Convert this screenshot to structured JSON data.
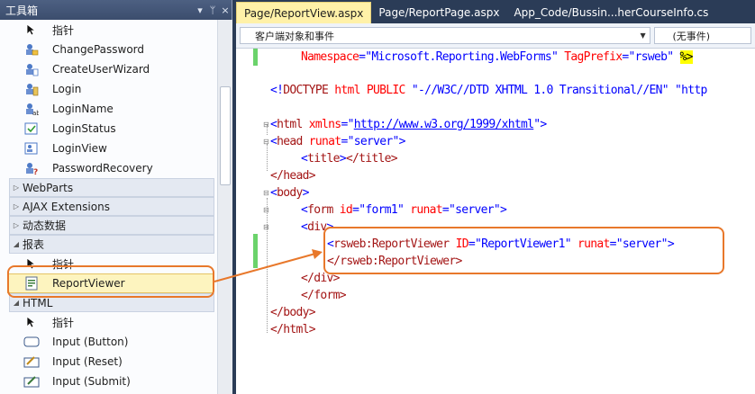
{
  "toolbox": {
    "title": "工具箱",
    "controls": [
      "▾",
      "ᛘ",
      "×"
    ],
    "login_items": [
      {
        "label": "指针",
        "icon": "pointer-icon"
      },
      {
        "label": "ChangePassword",
        "icon": "change-password-icon"
      },
      {
        "label": "CreateUserWizard",
        "icon": "create-user-wizard-icon"
      },
      {
        "label": "Login",
        "icon": "login-icon"
      },
      {
        "label": "LoginName",
        "icon": "login-name-icon"
      },
      {
        "label": "LoginStatus",
        "icon": "login-status-icon"
      },
      {
        "label": "LoginView",
        "icon": "login-view-icon"
      },
      {
        "label": "PasswordRecovery",
        "icon": "password-recovery-icon"
      }
    ],
    "categories": [
      {
        "label": "WebParts",
        "expanded": false
      },
      {
        "label": "AJAX Extensions",
        "expanded": false
      },
      {
        "label": "动态数据",
        "expanded": false
      },
      {
        "label": "报表",
        "expanded": true
      }
    ],
    "report_items": [
      {
        "label": "指针",
        "icon": "pointer-icon"
      },
      {
        "label": "ReportViewer",
        "icon": "report-viewer-icon",
        "selected": true
      }
    ],
    "html_category": {
      "label": "HTML",
      "expanded": true
    },
    "html_items": [
      {
        "label": "指针",
        "icon": "pointer-icon"
      },
      {
        "label": "Input (Button)",
        "icon": "input-button-icon"
      },
      {
        "label": "Input (Reset)",
        "icon": "input-reset-icon"
      },
      {
        "label": "Input (Submit)",
        "icon": "input-submit-icon"
      }
    ]
  },
  "editor": {
    "tabs": [
      {
        "label": "Page/ReportView.aspx",
        "active": true
      },
      {
        "label": "Page/ReportPage.aspx",
        "active": false
      },
      {
        "label": "App_Code/Bussin...herCourseInfo.cs",
        "active": false
      }
    ],
    "nav": {
      "object_combo": "客户端对象和事件",
      "event_combo": "(无事件)"
    },
    "code": {
      "line1": {
        "attr1": "Namespace",
        "val1": "\"Microsoft.Reporting.WebForms\"",
        "attr2": "TagPrefix",
        "val2": "\"rsweb\"",
        "end": "%>"
      },
      "line2": {
        "open": "<!",
        "name": "DOCTYPE",
        "rest": " html PUBLIC ",
        "v1": "\"-//W3C//DTD XHTML 1.0 Transitional//EN\"",
        "v2": "\"http"
      },
      "line3": {
        "open": "<",
        "tag": "html",
        "attr": "xmlns",
        "url": "http://www.w3.org/1999/xhtml",
        "close": ">"
      },
      "line4": {
        "tag": "head",
        "attr": "runat",
        "val": "\"server\""
      },
      "line5": {
        "tag": "title",
        "close": "</title>"
      },
      "line6": {
        "close": "</head>"
      },
      "line7": {
        "tag": "body"
      },
      "line8": {
        "tag": "form",
        "attr1": "id",
        "val1": "\"form1\"",
        "attr2": "runat",
        "val2": "\"server\""
      },
      "line9": {
        "tag": "div"
      },
      "line10": {
        "tag": "rsweb:ReportViewer",
        "attr1": "ID",
        "val1": "\"ReportViewer1\"",
        "attr2": "runat",
        "val2": "\"server\""
      },
      "line11": {
        "close": "</rsweb:ReportViewer>"
      },
      "line12": {
        "close": "</div>"
      },
      "line13": {
        "close": "</form>"
      },
      "line14": {
        "close": "</body>"
      },
      "line15": {
        "close": "</html>"
      }
    }
  },
  "colors": {
    "callout": "#e8782b",
    "active_tab": "#fff1a8",
    "selected_item": "#fdf4bf",
    "change_bar": "#6bd36b"
  }
}
